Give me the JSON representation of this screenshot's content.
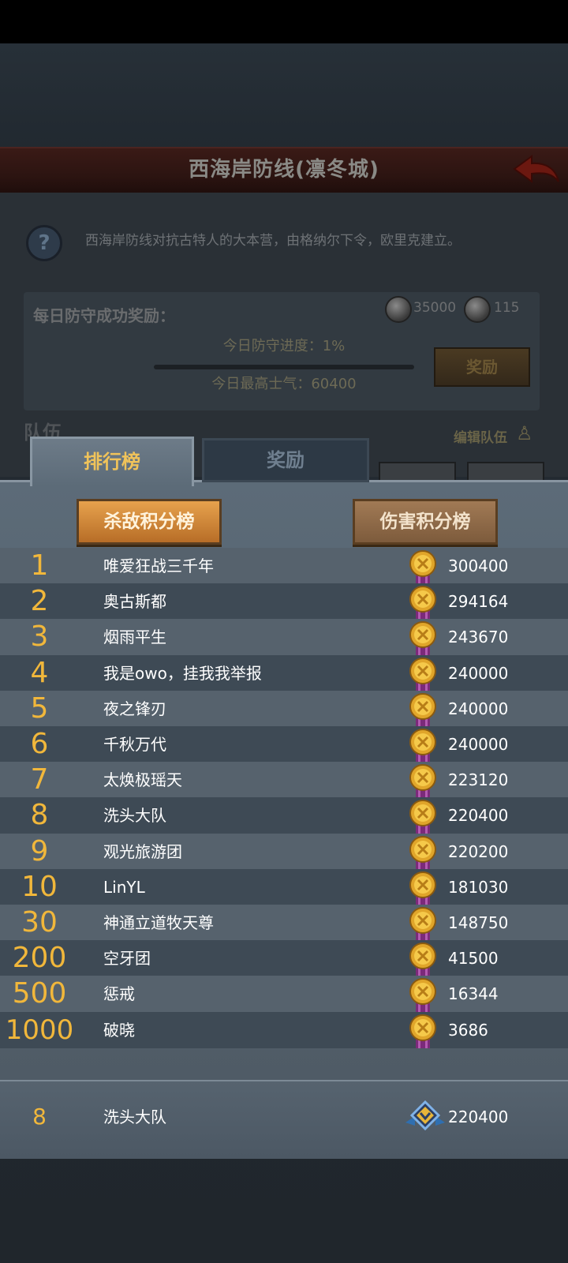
{
  "header": {
    "title": "西海岸防线(凛冬城)"
  },
  "info": {
    "description": "西海岸防线对抗古特人的大本营，由格纳尔下令，欧里克建立。",
    "daily_reward_label": "每日防守成功奖励：",
    "reward_coin_1": "35000",
    "reward_coin_2": "115",
    "progress_label": "今日防守进度：",
    "progress_value": "1%",
    "progress_fraction": 0.01,
    "morale_label": "今日最高士气：",
    "morale_value": "60400",
    "reward_button": "奖励",
    "team_label": "队伍",
    "edit_team": "编辑队伍"
  },
  "tabs": {
    "ranking": "排行榜",
    "rewards": "奖励"
  },
  "board_buttons": {
    "kill": "杀敌积分榜",
    "damage": "伤害积分榜"
  },
  "rows": [
    {
      "rank": "1",
      "name": "唯爱狂战三千年",
      "score": "300400"
    },
    {
      "rank": "2",
      "name": "奥古斯都",
      "score": "294164"
    },
    {
      "rank": "3",
      "name": "烟雨平生",
      "score": "243670"
    },
    {
      "rank": "4",
      "name": "我是owo，挂我我举报",
      "score": "240000"
    },
    {
      "rank": "5",
      "name": "夜之锋刃",
      "score": "240000"
    },
    {
      "rank": "6",
      "name": "千秋万代",
      "score": "240000"
    },
    {
      "rank": "7",
      "name": "太焕极瑶天",
      "score": "223120"
    },
    {
      "rank": "8",
      "name": "洗头大队",
      "score": "220400"
    },
    {
      "rank": "9",
      "name": "观光旅游团",
      "score": "220200"
    },
    {
      "rank": "10",
      "name": "LinYL",
      "score": "181030"
    },
    {
      "rank": "30",
      "name": "神通立道牧天尊",
      "score": "148750"
    },
    {
      "rank": "200",
      "name": "空牙团",
      "score": "41500"
    },
    {
      "rank": "500",
      "name": "惩戒",
      "score": "16344"
    },
    {
      "rank": "1000",
      "name": "破晓",
      "score": "3686"
    }
  ],
  "me": {
    "rank": "8",
    "name": "洗头大队",
    "score": "220400"
  },
  "colors": {
    "rank_gold": "#f1b73b",
    "tab_active_text": "#f0c35a",
    "kill_button": "#e7a24d"
  }
}
